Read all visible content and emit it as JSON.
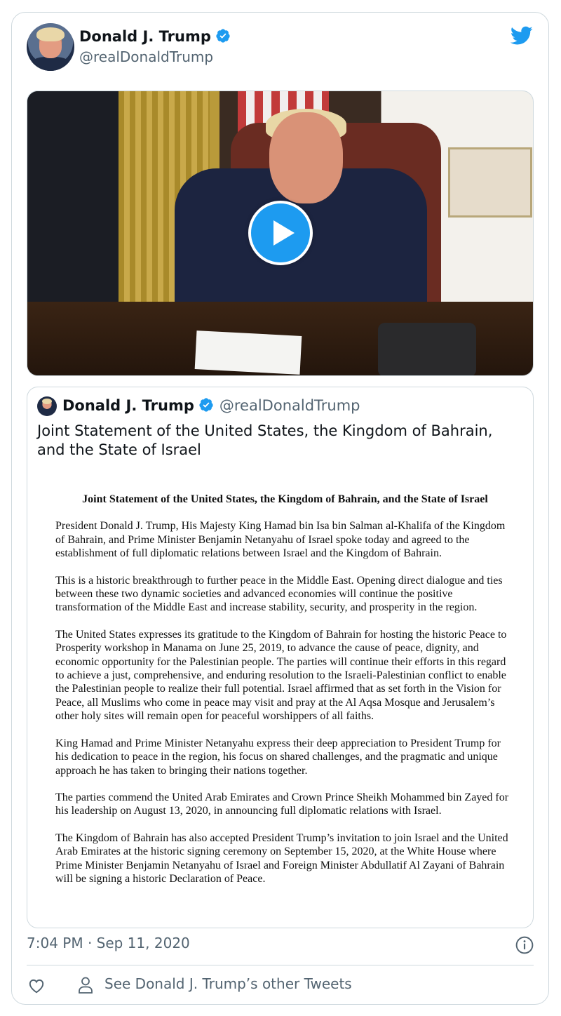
{
  "author": {
    "name": "Donald J. Trump",
    "handle": "@realDonaldTrump",
    "verified": true
  },
  "icons": {
    "brand": "twitter-bird-icon",
    "verified": "verified-badge-icon",
    "play": "play-icon",
    "info": "info-icon",
    "like": "heart-icon",
    "profile": "person-icon"
  },
  "media": {
    "type": "video"
  },
  "quoted_tweet": {
    "name": "Donald J. Trump",
    "handle": "@realDonaldTrump",
    "text": "Joint Statement of the United States, the Kingdom of Bahrain, and the State of Israel",
    "document": {
      "title": "Joint Statement of the United States, the Kingdom of Bahrain, and the State of Israel",
      "paragraphs": [
        "President Donald J. Trump, His Majesty King Hamad bin Isa bin Salman al-Khalifa of the Kingdom of Bahrain, and Prime Minister Benjamin Netanyahu of Israel spoke today and agreed to the establishment of full diplomatic relations between Israel and the Kingdom of Bahrain.",
        "This is a historic breakthrough to further peace in the Middle East.  Opening direct dialogue and ties between these two dynamic societies and advanced economies will continue the positive transformation of the Middle East and increase stability, security, and prosperity in the region.",
        "The United States expresses its gratitude to the Kingdom of Bahrain for hosting the historic Peace to Prosperity workshop in Manama on June 25, 2019, to advance the cause of peace, dignity, and economic opportunity for the Palestinian people.  The parties will continue their efforts in this regard to achieve a just, comprehensive, and enduring resolution to the Israeli-Palestinian conflict to enable the Palestinian people to realize their full potential.  Israel affirmed that as set forth in the Vision for Peace, all Muslims who come in peace may visit and pray at the Al Aqsa Mosque and Jerusalem’s other holy sites will remain open for peaceful worshippers of all faiths.",
        "King Hamad and Prime Minister Netanyahu express their deep appreciation to President Trump for his dedication to peace in the region, his focus on shared challenges, and the pragmatic and unique approach he has taken to bringing their nations together.",
        "The parties commend the United Arab Emirates and Crown Prince Sheikh Mohammed bin Zayed for his leadership on August 13, 2020, in announcing full diplomatic relations with Israel.",
        "The Kingdom of Bahrain has also accepted President Trump’s invitation to join Israel and the United Arab Emirates at the historic signing ceremony on September 15, 2020, at the White House where Prime Minister Benjamin Netanyahu of Israel and Foreign Minister Abdullatif Al Zayani of Bahrain will be signing a historic Declaration of Peace."
      ]
    }
  },
  "timestamp": "7:04 PM · Sep 11, 2020",
  "footer": {
    "other_tweets_label": "See Donald J. Trump’s other Tweets"
  },
  "colors": {
    "accent": "#1d9bf0",
    "secondary_text": "#536471",
    "border": "#cfd9de"
  }
}
